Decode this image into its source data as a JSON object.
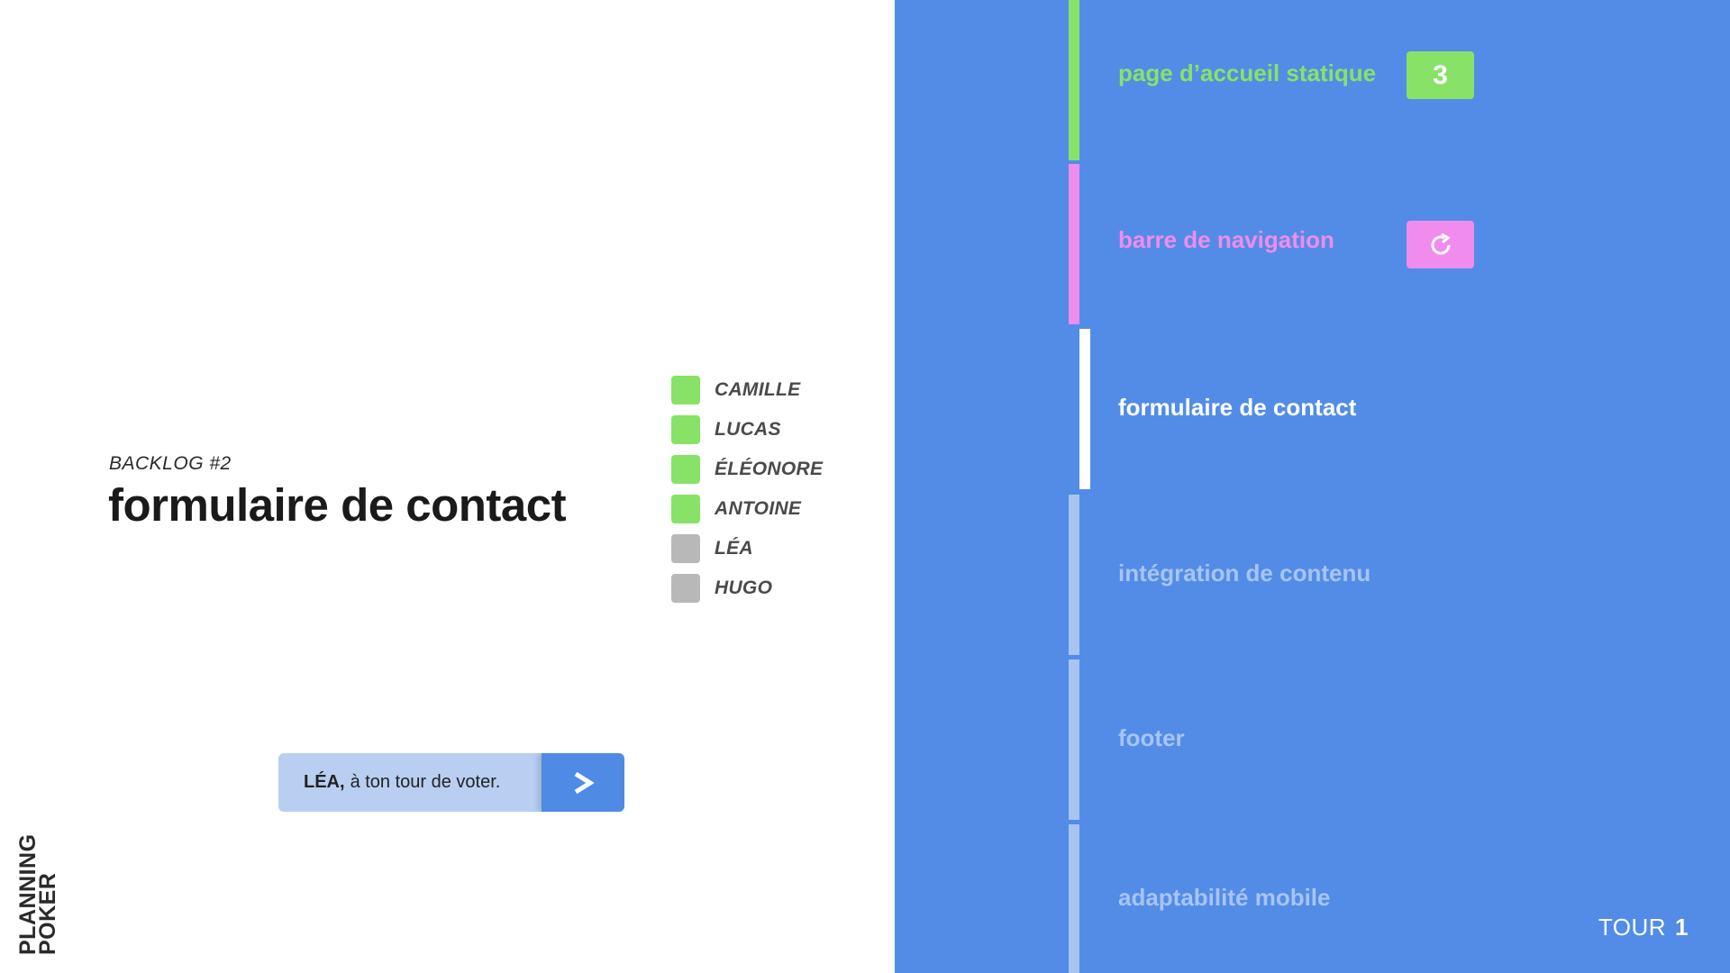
{
  "logo": {
    "line1": "PLANNING",
    "line2": "POKER"
  },
  "current_story": {
    "backlog_label": "BACKLOG #2",
    "title": "formulaire de contact"
  },
  "players": [
    {
      "name": "CAMILLE",
      "status": "voted",
      "color": "#88e268"
    },
    {
      "name": "LUCAS",
      "status": "voted",
      "color": "#88e268"
    },
    {
      "name": "ÉLÉONORE",
      "status": "voted",
      "color": "#88e268"
    },
    {
      "name": "ANTOINE",
      "status": "voted",
      "color": "#88e268"
    },
    {
      "name": "LÉA",
      "status": "pending",
      "color": "#b8b8b8"
    },
    {
      "name": "HUGO",
      "status": "pending",
      "color": "#b8b8b8"
    }
  ],
  "turn_prompt": {
    "who": "LÉA,",
    "message": "à ton tour de voter.",
    "button_icon": "chevron-right-icon"
  },
  "backlog": [
    {
      "title": "page d’accueil statique",
      "state": "estimated",
      "badge": "3",
      "color": "#88e268"
    },
    {
      "title": "barre de navigation",
      "state": "revote",
      "badge_icon": "refresh-icon",
      "color": "#f08cee"
    },
    {
      "title": "formulaire de contact",
      "state": "current",
      "color": "#ffffff"
    },
    {
      "title": "intégration de contenu",
      "state": "upcoming",
      "color": "#a7c4f2"
    },
    {
      "title": "footer",
      "state": "upcoming",
      "color": "#a7c4f2"
    },
    {
      "title": "adaptabilité mobile",
      "state": "upcoming",
      "color": "#a7c4f2"
    }
  ],
  "round": {
    "label": "TOUR",
    "number": "1"
  },
  "colors": {
    "panel": "#528ce6",
    "voted": "#88e268",
    "pending": "#b8b8b8"
  }
}
